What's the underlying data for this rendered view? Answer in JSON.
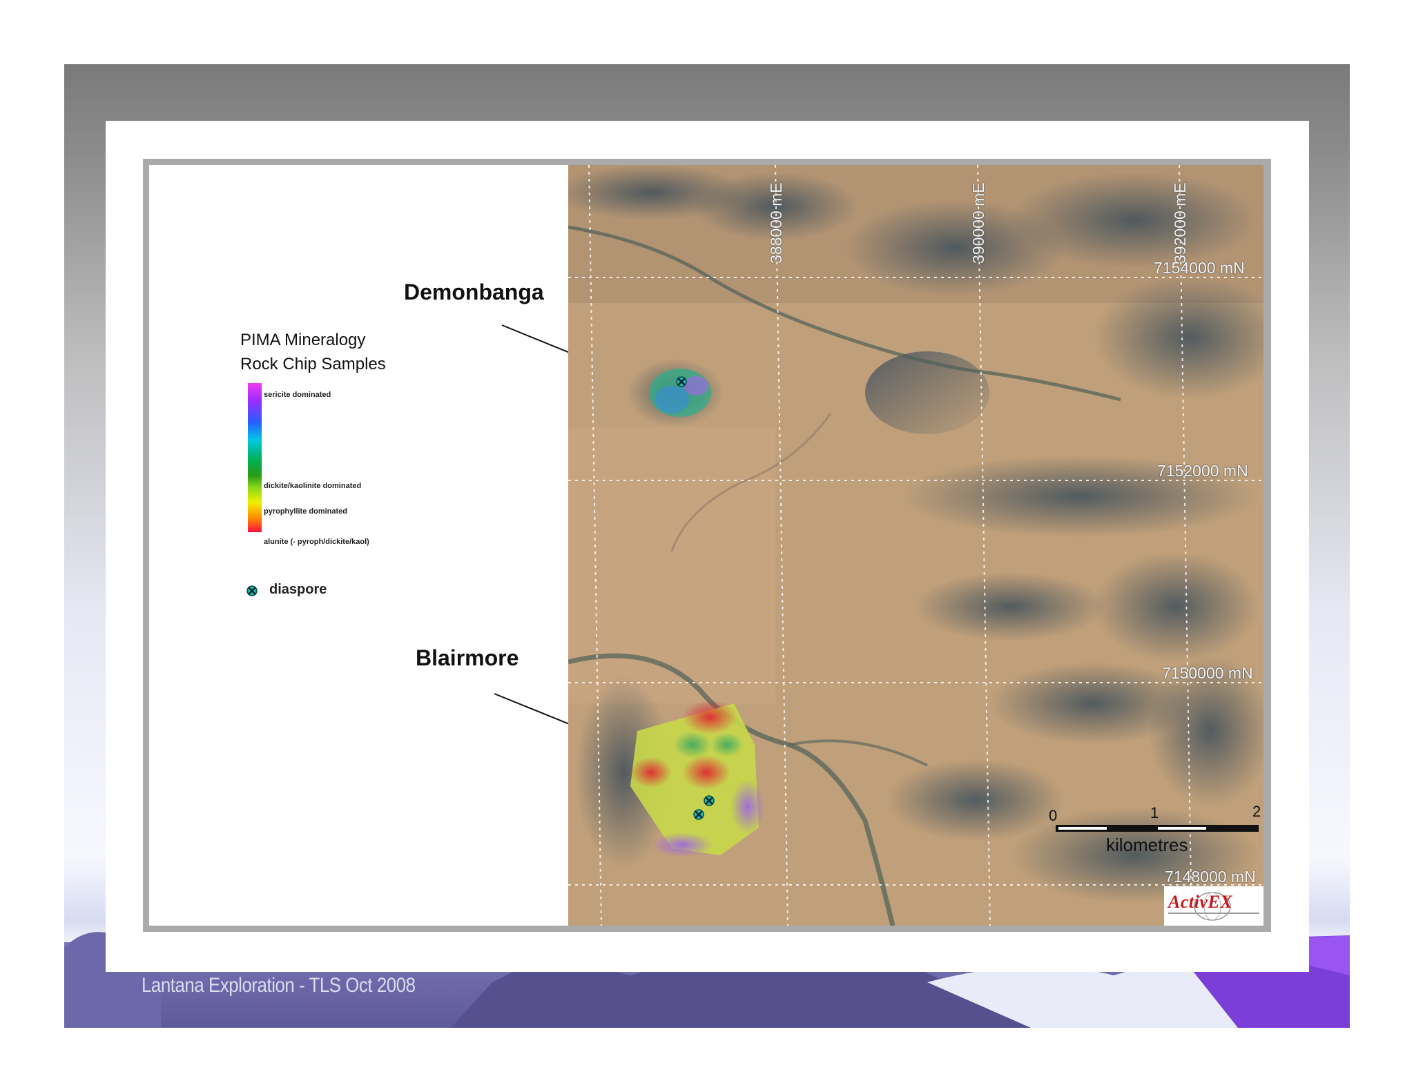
{
  "footer": {
    "text": "Lantana Exploration - TLS Oct 2008"
  },
  "legend": {
    "title_line1": "PIMA Mineralogy",
    "title_line2": "Rock Chip Samples",
    "ramp_labels": {
      "top": "sericite dominated",
      "mid": "dickite/kaolinite dominated",
      "mid2": "pyrophyllite dominated",
      "bottom": "alunite (- pyroph/dickite/kaol)"
    },
    "diaspore_label": "diaspore"
  },
  "places": {
    "demonbanga": "Demonbanga",
    "blairmore": "Blairmore"
  },
  "grid": {
    "eastings": [
      "388000 mE",
      "390000 mE",
      "392000 mE"
    ],
    "northings": [
      "7154000 mN",
      "7152000 mN",
      "7150000 mN",
      "7148000 mN"
    ]
  },
  "scale_bar": {
    "ticks": [
      "0",
      "1",
      "2"
    ],
    "unit": "kilometres"
  },
  "logo": {
    "text": "ActivEX"
  },
  "colors": {
    "sericite": "#f03cf0",
    "dickite_kaolinite": "#2a9a18",
    "pyrophyllite": "#f0f000",
    "alunite": "#ff1040",
    "footer_band": "#6a64a8"
  },
  "icons": {
    "diaspore": "diaspore-symbol-icon"
  }
}
